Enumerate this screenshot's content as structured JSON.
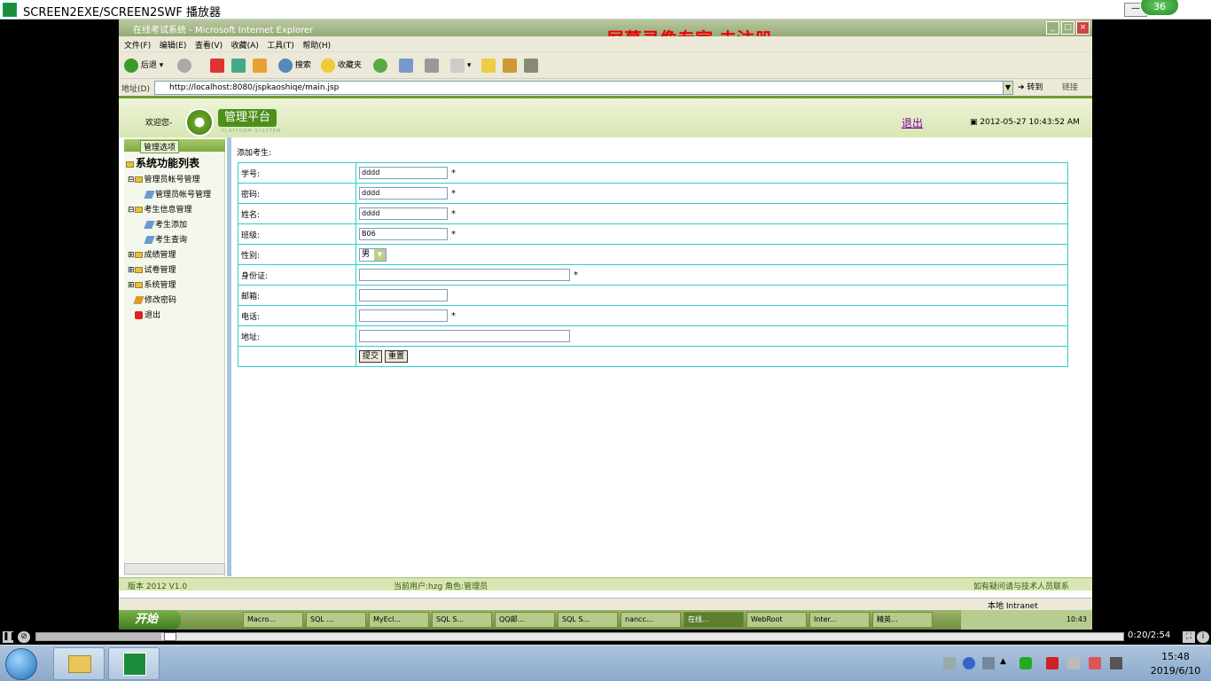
{
  "player": {
    "title": "SCREEN2EXE/SCREEN2SWF 播放器",
    "badge": "36",
    "time": "0:20/2:54"
  },
  "ie": {
    "title": "在线考试系统 - Microsoft Internet Explorer",
    "watermark": "屏幕录像专家  未注册",
    "menu": [
      "文件(F)",
      "编辑(E)",
      "查看(V)",
      "收藏(A)",
      "工具(T)",
      "帮助(H)"
    ],
    "toolbar": {
      "back": "后退",
      "search": "搜索",
      "favorites": "收藏夹"
    },
    "address_label": "地址(D)",
    "address": "http://localhost:8080/jspkaoshiqe/main.jsp",
    "go": "转到",
    "links": "链接",
    "status": "本地 Intranet"
  },
  "header": {
    "welcome": "欢迎您-",
    "logo_text": "管理平台",
    "logo_sub": "PLATFORM SYSYTEM",
    "logout": "退出",
    "datetime": "2012-05-27 10:43:52 AM"
  },
  "sidebar": {
    "tab": "管理选项",
    "title": "系统功能列表",
    "items": [
      {
        "label": "管理员帐号管理"
      },
      {
        "label": "管理员帐号管理"
      },
      {
        "label": "考生信息管理"
      },
      {
        "label": "考生添加"
      },
      {
        "label": "考生查询"
      },
      {
        "label": "成绩管理"
      },
      {
        "label": "试卷管理"
      },
      {
        "label": "系统管理"
      },
      {
        "label": "修改密码"
      },
      {
        "label": "退出"
      }
    ]
  },
  "form": {
    "title": "添加考生:",
    "rows": [
      {
        "label": "学号:",
        "value": "dddd",
        "required": "*"
      },
      {
        "label": "密码:",
        "value": "dddd",
        "required": "*"
      },
      {
        "label": "姓名:",
        "value": "dddd",
        "required": "*"
      },
      {
        "label": "班级:",
        "value": "B06",
        "required": "*"
      },
      {
        "label": "性别:",
        "value": "男",
        "required": ""
      },
      {
        "label": "身份证:",
        "value": "",
        "required": "*"
      },
      {
        "label": "邮箱:",
        "value": "",
        "required": ""
      },
      {
        "label": "电话:",
        "value": "",
        "required": "*"
      },
      {
        "label": "地址:",
        "value": "",
        "required": ""
      }
    ],
    "submit": "提交",
    "reset": "重置"
  },
  "footer": {
    "version": "版本 2012 V1.0",
    "user": "当前用户:hzg  角色:管理员",
    "help": "如有疑问请与技术人员联系"
  },
  "xp_taskbar": {
    "start": "开始",
    "tasks": [
      "Macro...",
      "SQL ...",
      "MyEcl...",
      "SQL S...",
      "QQ邮...",
      "SQL S...",
      "nancc...",
      "在线...",
      "WebRoot",
      "Inter...",
      "精英..."
    ],
    "clock": "10:43"
  },
  "w7": {
    "time": "15:48",
    "date": "2019/6/10"
  }
}
